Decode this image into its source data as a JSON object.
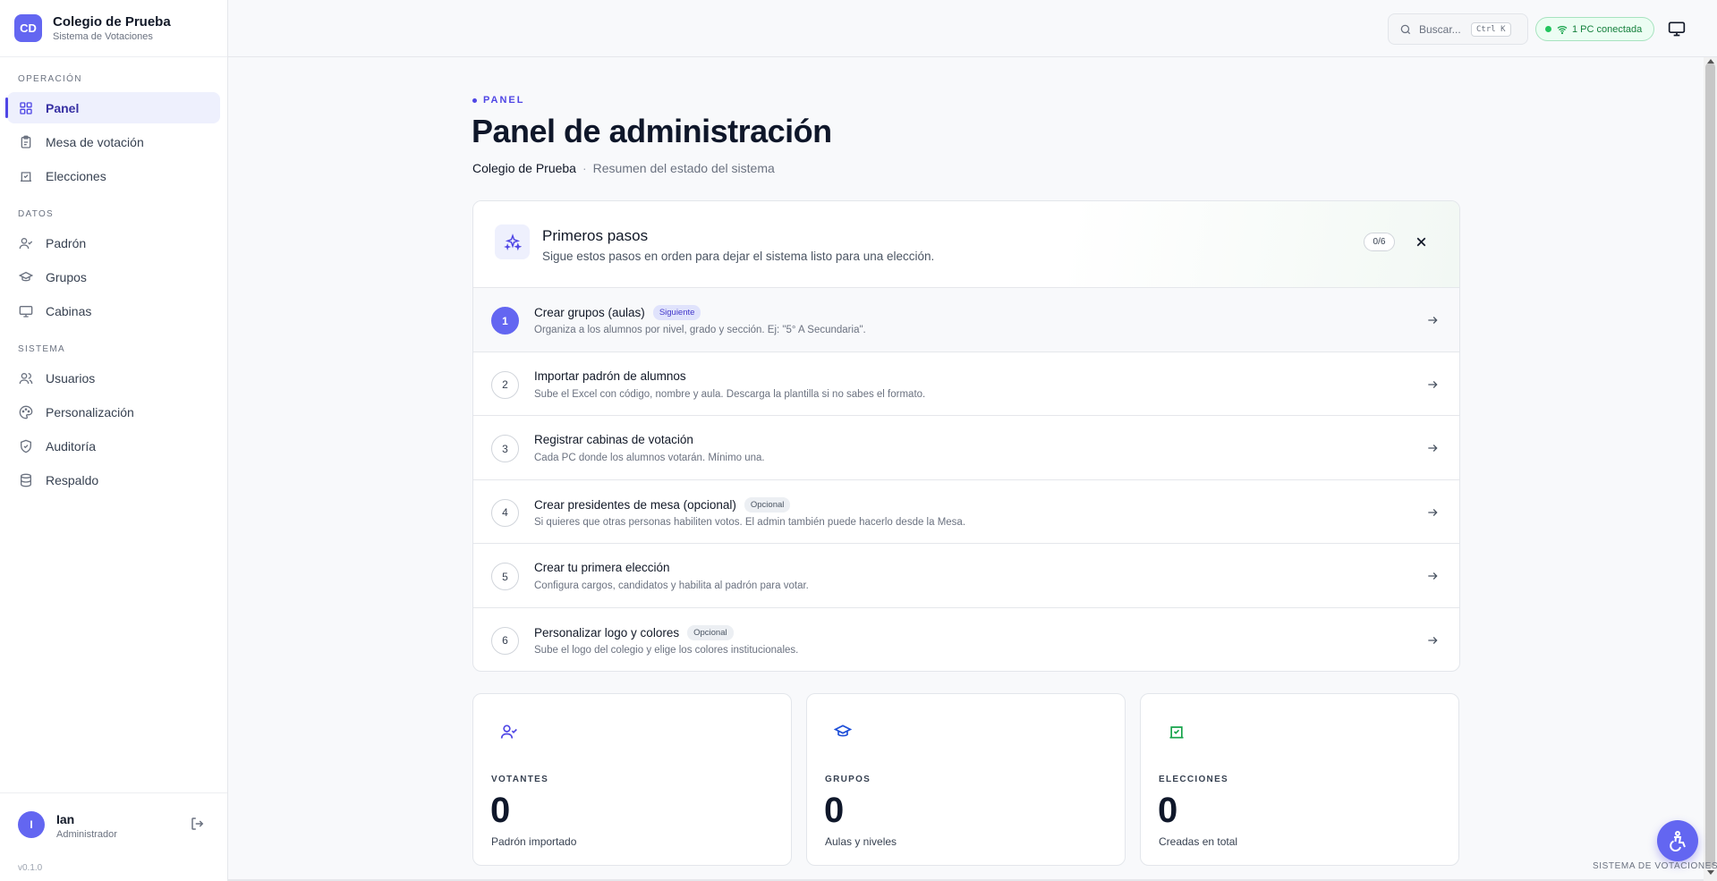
{
  "brand": {
    "initials": "CD",
    "name": "Colegio de Prueba",
    "subtitle": "Sistema de Votaciones",
    "color": "#6366f1"
  },
  "sidebar": {
    "sections": [
      {
        "label": "OPERACIÓN",
        "items": [
          {
            "label": "Panel",
            "icon": "grid-icon",
            "active": true
          },
          {
            "label": "Mesa de votación",
            "icon": "clipboard-icon"
          },
          {
            "label": "Elecciones",
            "icon": "ballot-box-icon"
          }
        ]
      },
      {
        "label": "DATOS",
        "items": [
          {
            "label": "Padrón",
            "icon": "user-check-icon"
          },
          {
            "label": "Grupos",
            "icon": "graduation-cap-icon"
          },
          {
            "label": "Cabinas",
            "icon": "monitor-icon"
          }
        ]
      },
      {
        "label": "SISTEMA",
        "items": [
          {
            "label": "Usuarios",
            "icon": "users-icon"
          },
          {
            "label": "Personalización",
            "icon": "palette-icon"
          },
          {
            "label": "Auditoría",
            "icon": "shield-check-icon"
          },
          {
            "label": "Respaldo",
            "icon": "database-icon"
          }
        ]
      }
    ]
  },
  "user": {
    "initial": "I",
    "name": "Ian",
    "role": "Administrador",
    "version": "v0.1.0"
  },
  "topbar": {
    "search_placeholder": "Buscar...",
    "search_shortcut": "Ctrl K",
    "status": "1 PC conectada"
  },
  "page": {
    "eyebrow": "PANEL",
    "title": "Panel de administración",
    "school": "Colegio de Prueba",
    "separator": "·",
    "summary": "Resumen del estado del sistema"
  },
  "onboarding": {
    "title": "Primeros pasos",
    "description": "Sigue estos pasos en orden para dejar el sistema listo para una elección.",
    "progress": "0/6",
    "steps": [
      {
        "num": "1",
        "title": "Crear grupos (aulas)",
        "badge": "Siguiente",
        "badge_type": "next",
        "desc": "Organiza a los alumnos por nivel, grado y sección. Ej: \"5° A Secundaria\".",
        "current": true
      },
      {
        "num": "2",
        "title": "Importar padrón de alumnos",
        "badge": "",
        "desc": "Sube el Excel con código, nombre y aula. Descarga la plantilla si no sabes el formato."
      },
      {
        "num": "3",
        "title": "Registrar cabinas de votación",
        "badge": "",
        "desc": "Cada PC donde los alumnos votarán. Mínimo una."
      },
      {
        "num": "4",
        "title": "Crear presidentes de mesa (opcional)",
        "badge": "Opcional",
        "badge_type": "opt",
        "desc": "Si quieres que otras personas habiliten votos. El admin también puede hacerlo desde la Mesa."
      },
      {
        "num": "5",
        "title": "Crear tu primera elección",
        "badge": "",
        "desc": "Configura cargos, candidatos y habilita al padrón para votar."
      },
      {
        "num": "6",
        "title": "Personalizar logo y colores",
        "badge": "Opcional",
        "badge_type": "opt",
        "desc": "Sube el logo del colegio y elige los colores institucionales."
      }
    ]
  },
  "stats": [
    {
      "label": "VOTANTES",
      "value": "0",
      "sub": "Padrón importado",
      "icon": "user-check-icon",
      "color": "#4f46e5"
    },
    {
      "label": "GRUPOS",
      "value": "0",
      "sub": "Aulas y niveles",
      "icon": "graduation-cap-icon",
      "color": "#1d4ed8"
    },
    {
      "label": "ELECCIONES",
      "value": "0",
      "sub": "Creadas en total",
      "icon": "ballot-box-icon",
      "color": "#16a34a"
    }
  ],
  "footer": {
    "tag": "SISTEMA DE VOTACIONES"
  },
  "colors": {
    "accent": "#4f46e5",
    "success": "#16a34a",
    "status_bg": "#ecfdf3"
  }
}
